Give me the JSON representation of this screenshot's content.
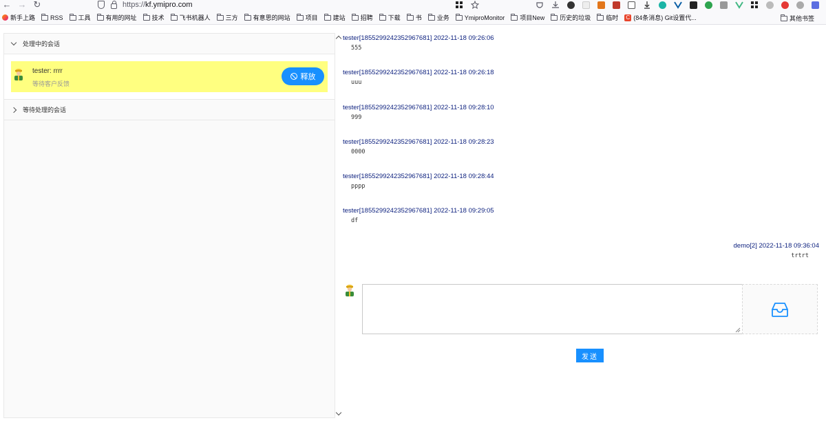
{
  "browser": {
    "url_prefix": "https://",
    "url_host": "kf.ymipro.com",
    "bookmarks": [
      {
        "label": "新手上路",
        "icon": "firefox-icon"
      },
      {
        "label": "RSS",
        "icon": "folder-icon"
      },
      {
        "label": "工具",
        "icon": "folder-icon"
      },
      {
        "label": "有用的网址",
        "icon": "folder-icon"
      },
      {
        "label": "技术",
        "icon": "folder-icon"
      },
      {
        "label": "飞书机器人",
        "icon": "folder-icon"
      },
      {
        "label": "三方",
        "icon": "folder-icon"
      },
      {
        "label": "有意思的网站",
        "icon": "folder-icon"
      },
      {
        "label": "项目",
        "icon": "folder-icon"
      },
      {
        "label": "建站",
        "icon": "folder-icon"
      },
      {
        "label": "招聘",
        "icon": "folder-icon"
      },
      {
        "label": "下载",
        "icon": "folder-icon"
      },
      {
        "label": "书",
        "icon": "folder-icon"
      },
      {
        "label": "业务",
        "icon": "folder-icon"
      },
      {
        "label": "YmiproMonitor",
        "icon": "folder-icon"
      },
      {
        "label": "项目New",
        "icon": "folder-icon"
      },
      {
        "label": "历史的垃圾",
        "icon": "folder-icon"
      },
      {
        "label": "临时",
        "icon": "folder-icon"
      },
      {
        "label": "(84条消息) Git设置代...",
        "icon": "csdn-icon"
      }
    ],
    "other_bookmarks": "其他书签"
  },
  "left": {
    "processing_title": "处理中的会话",
    "waiting_title": "等待处理的会话",
    "session": {
      "name": "tester: rrrr",
      "status": "等待客户反馈",
      "release_label": "释放"
    }
  },
  "messages": [
    {
      "head": "tester[1855299242352967681] 2022-11-18 09:26:06",
      "body": "555"
    },
    {
      "head": "tester[1855299242352967681] 2022-11-18 09:26:18",
      "body": "uuu"
    },
    {
      "head": "tester[1855299242352967681] 2022-11-18 09:28:10",
      "body": "999"
    },
    {
      "head": "tester[1855299242352967681] 2022-11-18 09:28:23",
      "body": "0000"
    },
    {
      "head": "tester[1855299242352967681] 2022-11-18 09:28:44",
      "body": "pppp"
    },
    {
      "head": "tester[1855299242352967681] 2022-11-18 09:29:05",
      "body": "df"
    },
    {
      "head": "demo[2] 2022-11-18 09:36:04",
      "body": "trtrt"
    }
  ],
  "composer": {
    "send_label": "发送",
    "upload_icon": "inbox-icon"
  },
  "colors": {
    "accent": "#1890ff",
    "session_highlight": "#ffff80",
    "message_header": "#0a1e7d"
  }
}
